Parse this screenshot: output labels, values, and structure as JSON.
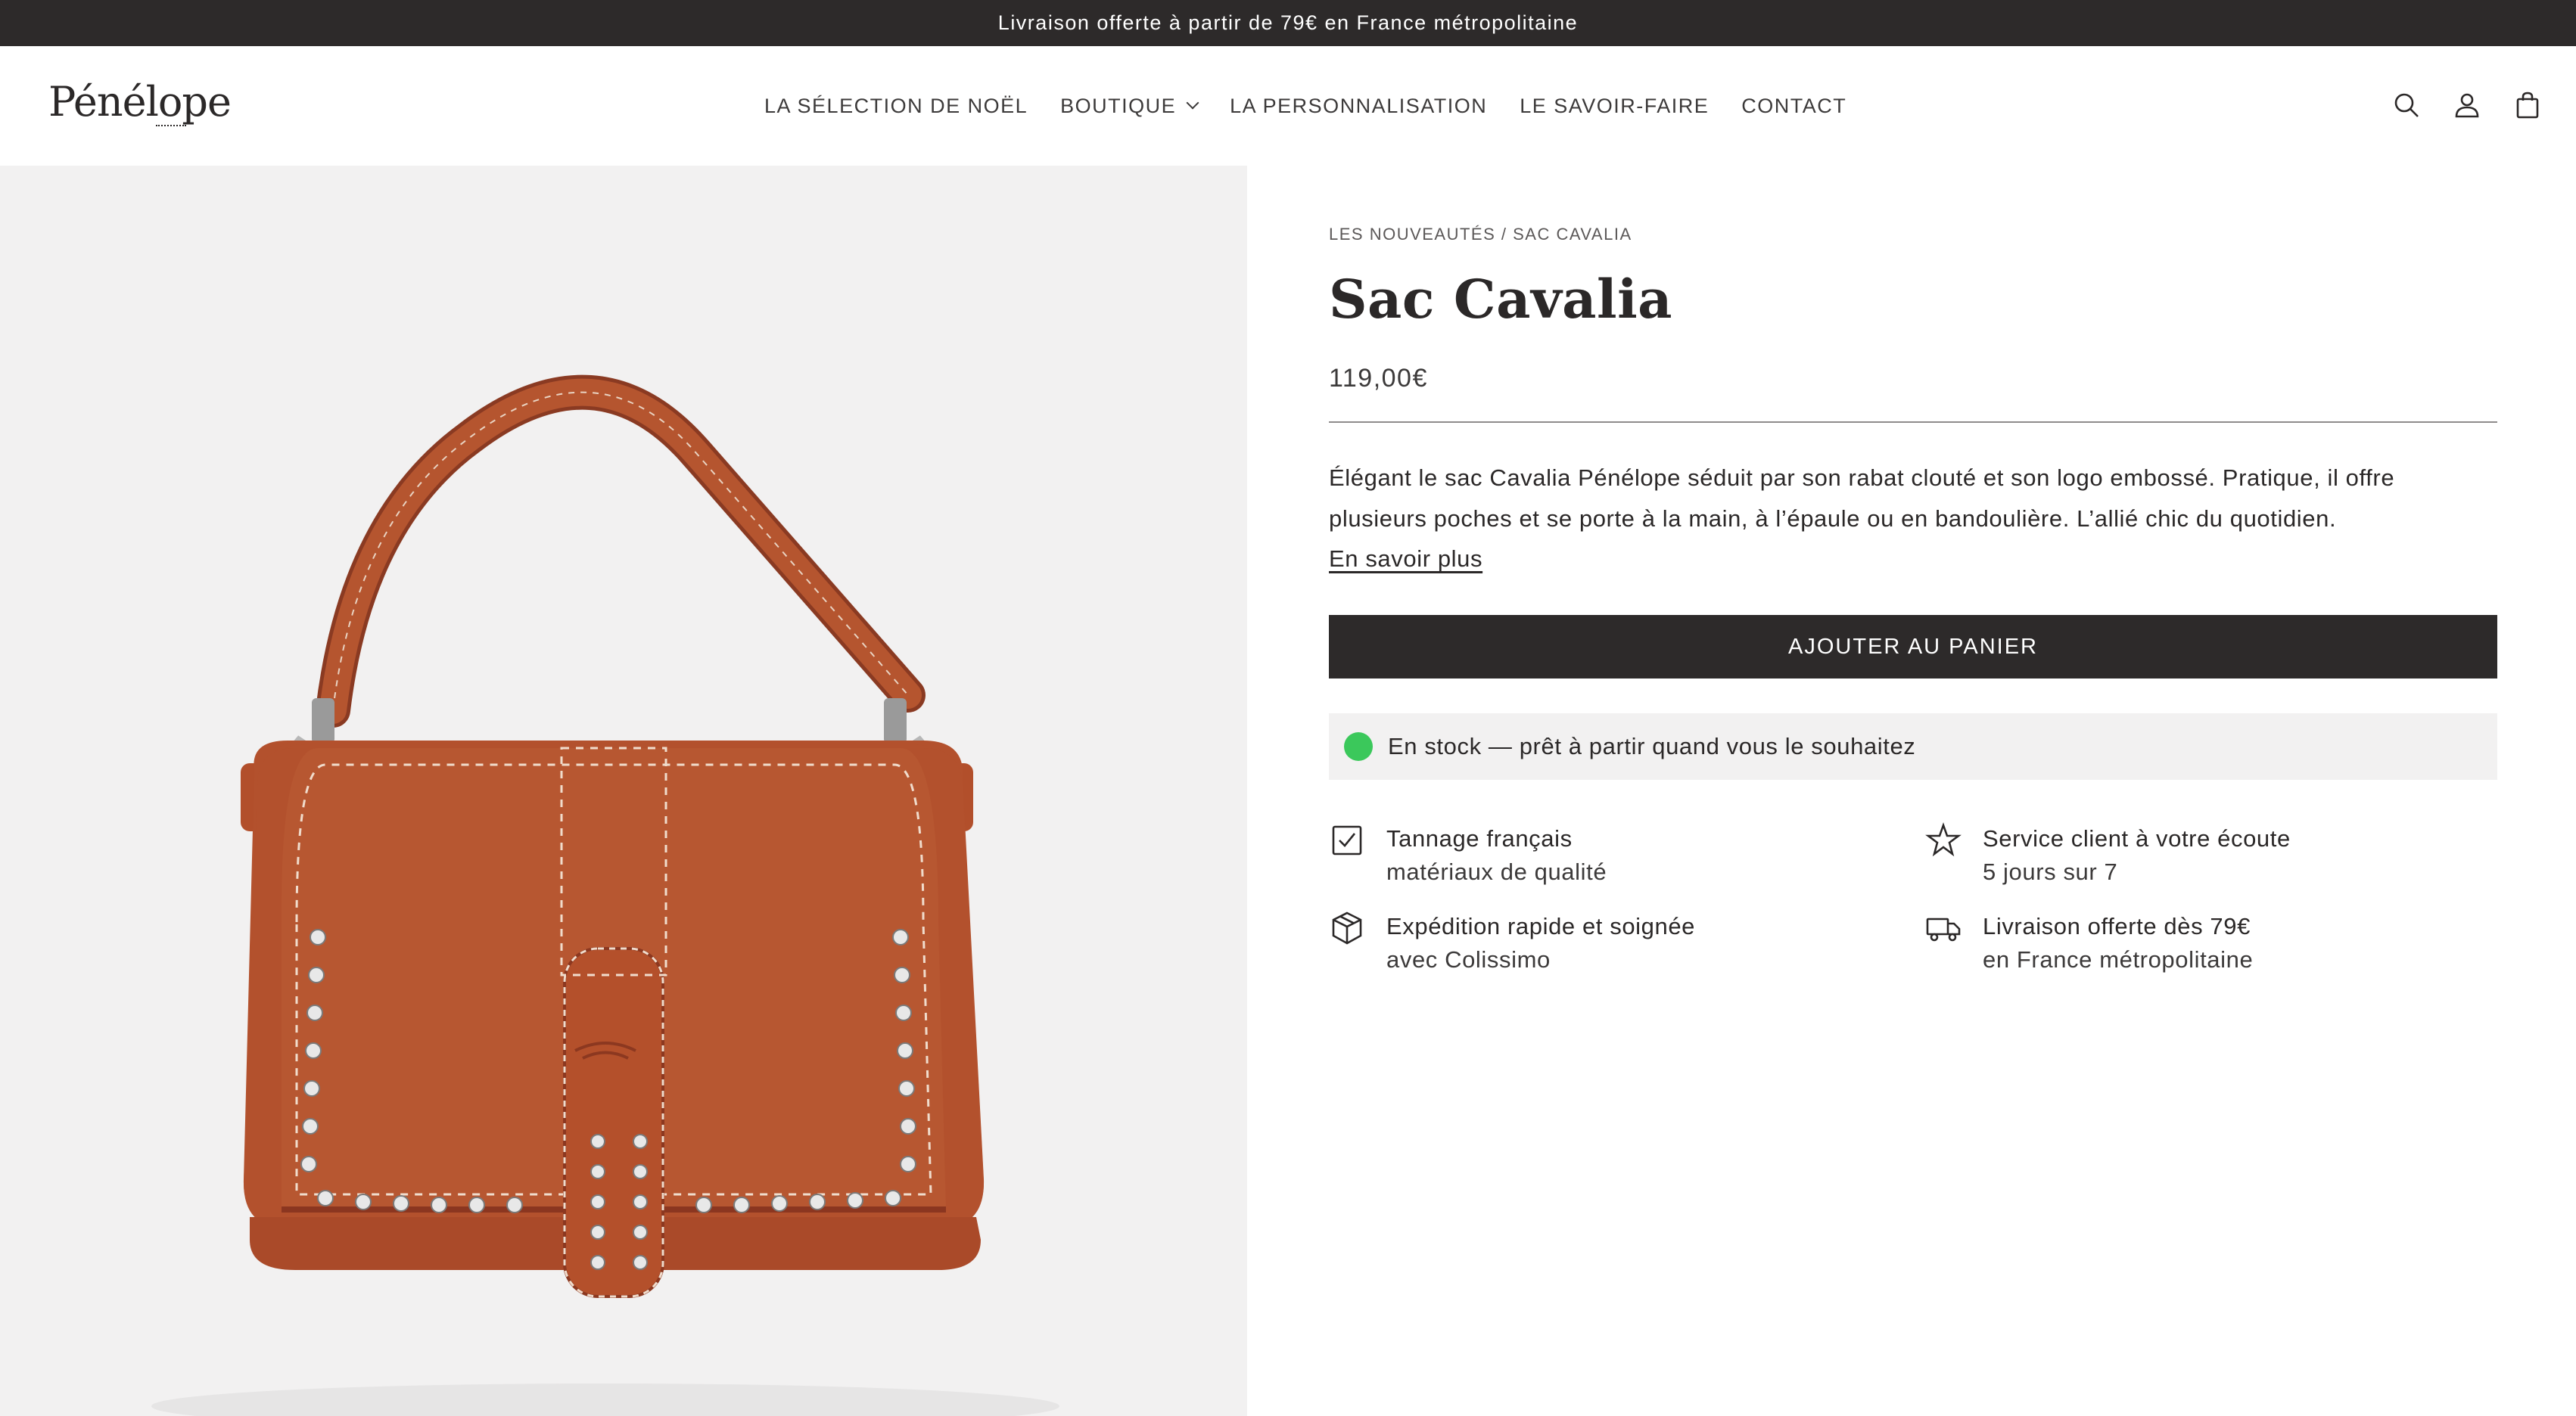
{
  "announcement": "Livraison offerte à partir de 79€ en France métropolitaine",
  "header": {
    "logo": "Pénélope",
    "nav": [
      {
        "label": "LA SÉLECTION DE NOËL"
      },
      {
        "label": "BOUTIQUE",
        "has_dropdown": true
      },
      {
        "label": "LA PERSONNALISATION"
      },
      {
        "label": "LE SAVOIR-FAIRE"
      },
      {
        "label": "CONTACT"
      }
    ],
    "icons": [
      "search-icon",
      "account-icon",
      "cart-icon"
    ]
  },
  "product": {
    "breadcrumb": "LES NOUVEAUTÉS / SAC CAVALIA",
    "title": "Sac Cavalia",
    "price": "119,00€",
    "description": "Élégant le sac Cavalia Pénélope séduit par son rabat clouté et son logo embossé. Pratique, il offre plusieurs poches et se porte à la main, à l’épaule ou en bandoulière. L’allié chic du quotidien.",
    "learn_more": "En savoir plus",
    "add_to_cart": "AJOUTER AU PANIER",
    "stock": "En stock — prêt à partir quand vous le souhaitez",
    "features": [
      {
        "icon": "checkbox-icon",
        "title": "Tannage français",
        "subtitle": "matériaux de qualité"
      },
      {
        "icon": "star-icon",
        "title": "Service client à votre écoute",
        "subtitle": "5 jours sur 7"
      },
      {
        "icon": "box-icon",
        "title": "Expédition rapide et soignée",
        "subtitle": "avec Colissimo"
      },
      {
        "icon": "truck-icon",
        "title": "Livraison offerte dès 79€",
        "subtitle": "en France métropolitaine"
      }
    ]
  },
  "colors": {
    "dark": "#2d2a2a",
    "media_bg": "#f2f1f1",
    "stock_green": "#3bc85b",
    "leather": "#b5552f"
  }
}
